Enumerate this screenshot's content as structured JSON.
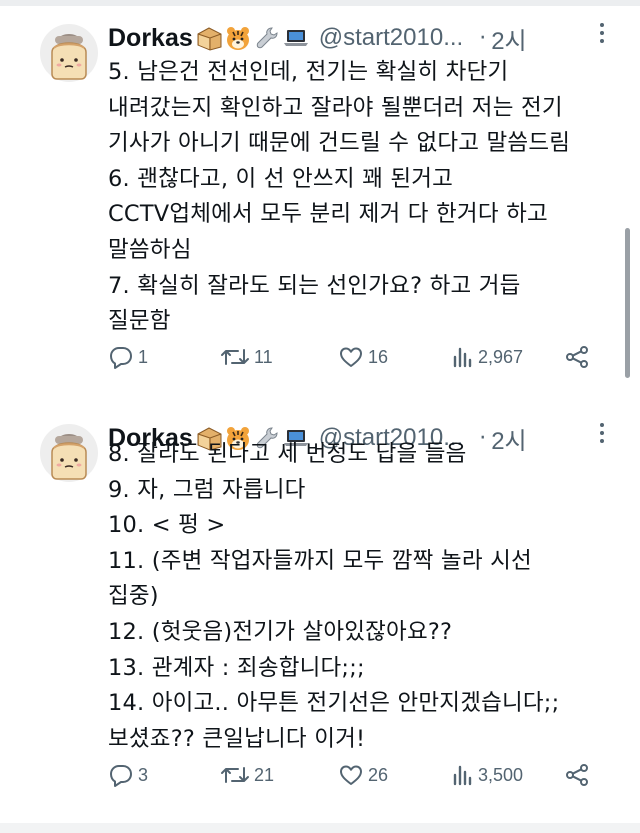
{
  "tweets": [
    {
      "author": {
        "name": "Dorkas",
        "emojis": [
          "bread-emoji",
          "tiger-emoji",
          "wrench-emoji",
          "laptop-emoji"
        ],
        "handle": "@start2010...",
        "time": "2시"
      },
      "lines": [
        "5. 남은건 전선인데, 전기는 확실히 차단기",
        "내려갔는지 확인하고 잘라야 될뿐더러 저는 전기",
        "기사가 아니기 때문에 건드릴 수 없다고 말씀드림",
        "6. 괜찮다고, 이 선 안쓰지 꽤 된거고",
        "CCTV업체에서 모두 분리 제거 다 한거다 하고",
        "말씀하심",
        "7. 확실히 잘라도 되는 선인가요? 하고 거듭",
        "질문함"
      ],
      "stats": {
        "replies": "1",
        "retweets": "11",
        "likes": "16",
        "views": "2,967"
      }
    },
    {
      "author": {
        "name": "Dorkas",
        "emojis": [
          "bread-emoji",
          "tiger-emoji",
          "wrench-emoji",
          "laptop-emoji"
        ],
        "handle": "@start2010...",
        "time": "2시"
      },
      "lines": [
        "8. 잘라도 된다고 세 번정도 답을 들음",
        "9. 자, 그럼 자릅니다",
        "10. < 펑 >",
        "11. (주변 작업자들까지 모두 깜짝 놀라 시선",
        "집중)",
        "12. (헛웃음)전기가 살아있잖아요??",
        "13. 관계자 : 죄송합니다;;;",
        "14. 아이고.. 아무튼 전기선은 안만지겠습니다;;",
        "보셨죠?? 큰일납니다 이거!"
      ],
      "stats": {
        "replies": "3",
        "retweets": "21",
        "likes": "26",
        "views": "3,500"
      }
    }
  ],
  "colors": {
    "text": "#0f1419",
    "secondary": "#536471",
    "background": "#ffffff"
  }
}
